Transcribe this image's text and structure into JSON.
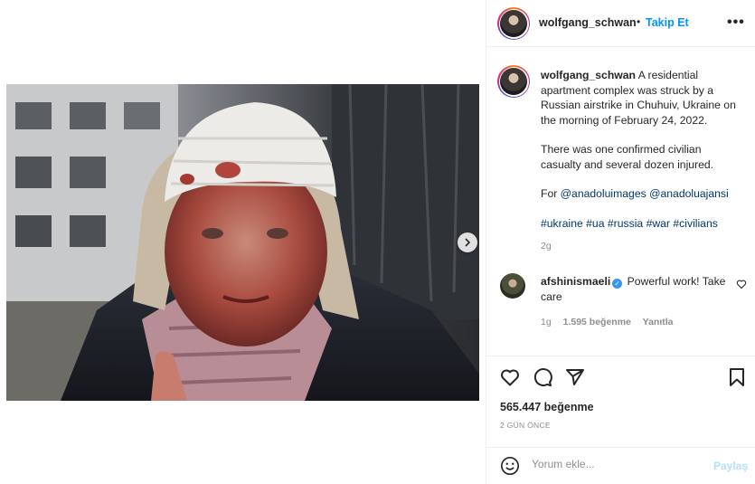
{
  "post": {
    "author": "wolfgang_schwan",
    "follow_label": "Takip Et",
    "separator": "•",
    "more_label": "•••",
    "caption": {
      "line1": "A residential apartment complex was struck by a Russian airstrike in Chuhuiv, Ukraine on the morning of February 24, 2022.",
      "line2": "There was one confirmed civilian casualty and several dozen injured.",
      "for_prefix": "For",
      "mention1": "@anadoluimages",
      "mention2": "@anadoluajansi",
      "hashtags": [
        "#ukraine",
        "#ua",
        "#russia",
        "#war",
        "#civilians"
      ]
    },
    "caption_time": "2g",
    "likes": "565.447 beğenme",
    "date": "2 GÜN ÖNCE"
  },
  "comment": {
    "author": "afshinismaeli",
    "text": "Powerful work! Take care",
    "time": "1g",
    "likes": "1.595 beğenme",
    "reply": "Yanıtla"
  },
  "composer": {
    "placeholder": "Yorum ekle...",
    "post_label": "Paylaş"
  },
  "colors": {
    "link": "#00376b",
    "accent": "#0095f6",
    "muted": "#8e8e8e"
  }
}
